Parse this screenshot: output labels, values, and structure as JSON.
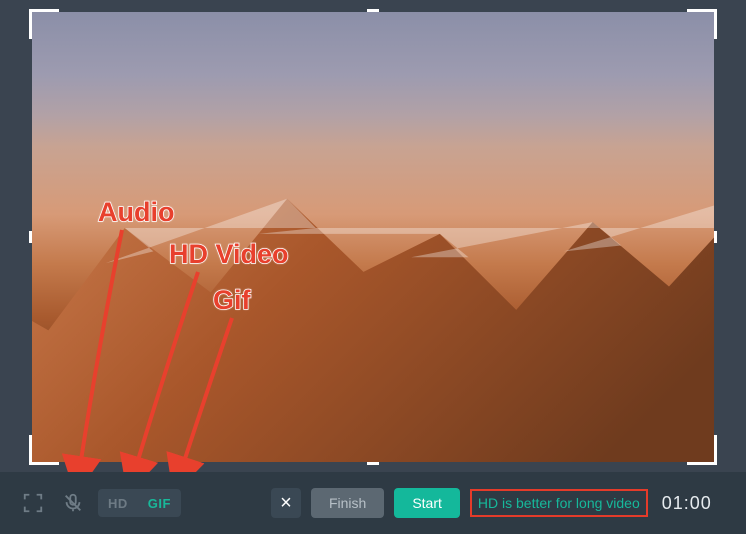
{
  "annotations": {
    "audio_label": "Audio",
    "hd_label": "HD Video",
    "gif_label": "Gif"
  },
  "toolbar": {
    "toggle_options": {
      "hd": "HD",
      "gif": "GIF",
      "selected": "GIF"
    },
    "close_symbol": "×",
    "finish_label": "Finish",
    "start_label": "Start",
    "tip_text": "HD is better for long video",
    "timer": "01:00"
  },
  "colors": {
    "accent_green": "#14b89b",
    "annotation_red": "#e8402d",
    "bar_bg": "#2e3a44"
  }
}
